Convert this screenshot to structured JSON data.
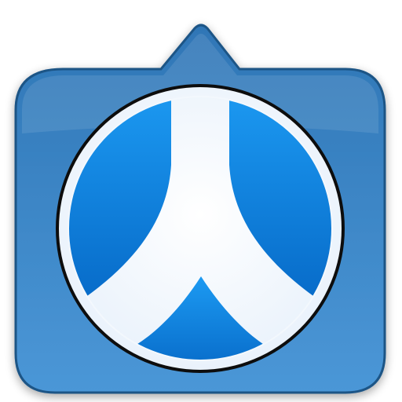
{
  "icon": {
    "name": "speech-bubble-app-icon",
    "symbol": "stylized-person-character-icon",
    "colors": {
      "tile_top": "#2f76b6",
      "tile_bottom": "#4b97d7",
      "tile_border": "#1f5586",
      "disc_fill": "#f3f8fd",
      "disc_border": "#0d0d0d",
      "blue_fill_light": "#1c9af2",
      "blue_fill_dark": "#0668c6",
      "background": "#ffffff"
    }
  }
}
